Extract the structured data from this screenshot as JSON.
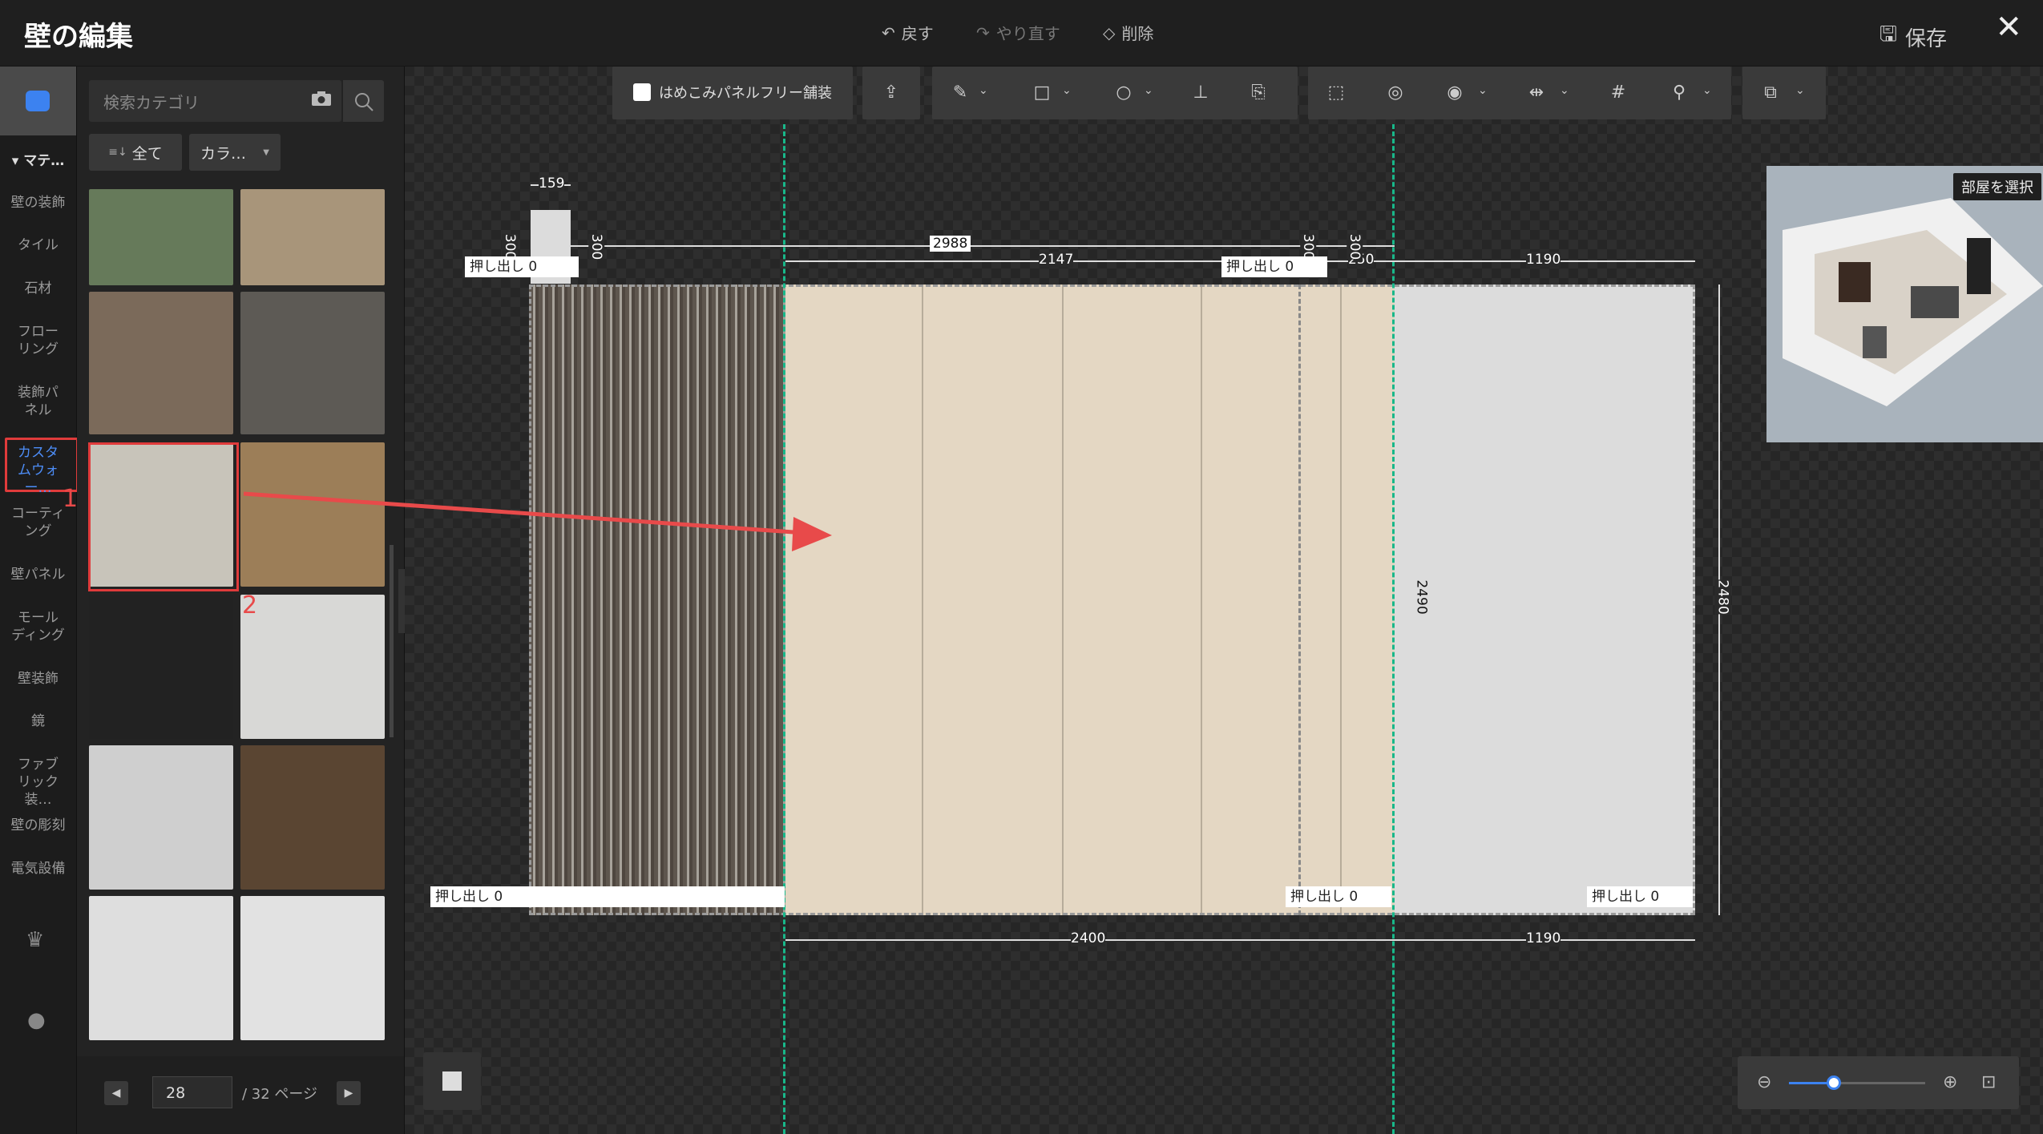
{
  "app": {
    "title": "壁の編集"
  },
  "toolbar_top": {
    "undo_label": "戻す",
    "redo_label": "やり直す",
    "delete_label": "削除",
    "save_label": "保存"
  },
  "left_nav": {
    "section_label": "マテ…",
    "items": [
      {
        "label": "壁の装飾"
      },
      {
        "label": "タイル"
      },
      {
        "label": "石材"
      },
      {
        "label": "フローリング"
      },
      {
        "label": "装飾パネル"
      },
      {
        "label": "カスタムウォー…",
        "active": true
      },
      {
        "label": "コーティング"
      },
      {
        "label": "壁パネル"
      },
      {
        "label": "モールディング"
      },
      {
        "label": "壁装飾"
      },
      {
        "label": "鏡"
      },
      {
        "label": "ファブリック装…"
      },
      {
        "label": "壁の彫刻"
      },
      {
        "label": "電気設備"
      }
    ],
    "annotation_1": "1"
  },
  "panel": {
    "search_placeholder": "検索カテゴリ",
    "filter_all": "全て",
    "filter_color": "カラ…",
    "annotation_2": "2",
    "tiles": [
      {
        "color": "#667a5a"
      },
      {
        "color": "#a8957a"
      },
      {
        "color": "#7b6a5a"
      },
      {
        "color": "#5d5a55"
      },
      {
        "color": "#c8c4ba",
        "selected": true
      },
      {
        "color": "#9c7e58"
      },
      {
        "color": "#222222"
      },
      {
        "color": "#d8d8d6"
      },
      {
        "color": "#cfcfcf"
      },
      {
        "color": "#5a4532"
      },
      {
        "color": "#dedede"
      },
      {
        "color": "#e2e2e2"
      }
    ],
    "pager": {
      "current": "28",
      "total_label": "/ 32 ページ"
    }
  },
  "edit_toolbar": {
    "checkbox_label": "はめこみパネルフリー舗装"
  },
  "dimensions": {
    "top_159": "159",
    "top_2988": "2988",
    "top_2147": "2147",
    "top_250": "250",
    "top_1190": "1190",
    "bottom_2400": "2400",
    "bottom_1190": "1190",
    "height_2490": "2490",
    "height_2480": "2480",
    "v_300_a": "300",
    "v_300_b": "300",
    "v_300_c": "300",
    "v_300_d": "300"
  },
  "push_labels": {
    "top_left": "押し出し  0",
    "top_mid": "押し出し  0",
    "bottom_left": "押し出し  0",
    "bottom_mid": "押し出し  0",
    "bottom_right": "押し出し  0"
  },
  "preview": {
    "select_room_label": "部屋を選択"
  },
  "zoom": {
    "level": 0.33
  }
}
